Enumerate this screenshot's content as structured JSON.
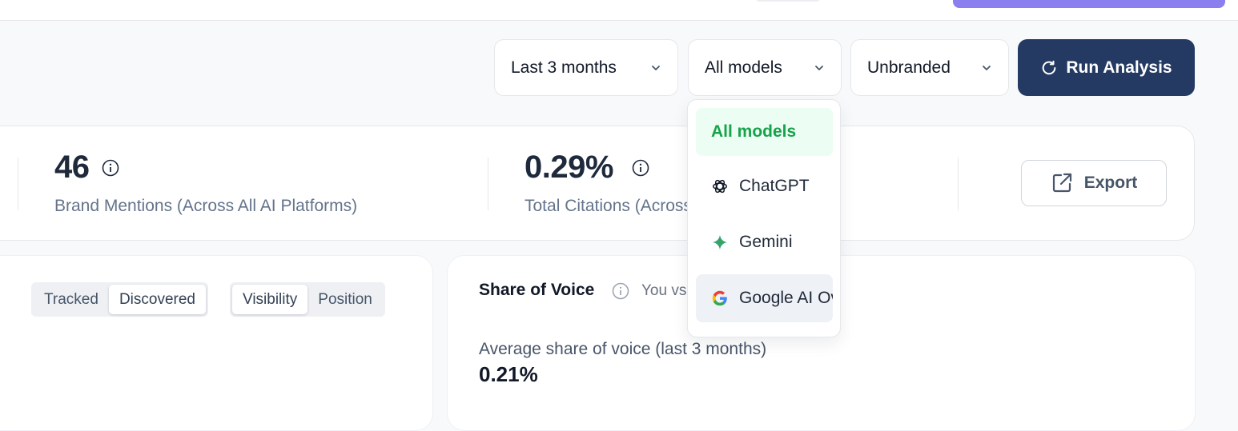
{
  "colors": {
    "primary": "#243a63",
    "accent": "#8b7ff0",
    "selected_text": "#16a34a",
    "selected_bg": "#ecfdf3"
  },
  "filters": {
    "period": "Last 3 months",
    "model": "All models",
    "branding": "Unbranded"
  },
  "actions": {
    "run_label": "Run Analysis",
    "export_label": "Export"
  },
  "stats": [
    {
      "value": "46",
      "label": "Brand Mentions (Across All AI Platforms)"
    },
    {
      "value": "0.29%",
      "label": "Total Citations (Across All AI Platforms)"
    }
  ],
  "toggles": {
    "source": [
      "Tracked",
      "Discovered"
    ],
    "source_active": "Discovered",
    "metric": [
      "Visibility",
      "Position"
    ],
    "metric_active": "Visibility"
  },
  "share_of_voice": {
    "title": "Share of Voice",
    "subtitle": "You vs competitors",
    "avg_label": "Average share of voice (last 3 months)",
    "avg_value": "0.21%"
  },
  "model_menu": {
    "items": [
      {
        "label": "All models",
        "icon": "none",
        "state": "selected"
      },
      {
        "label": "ChatGPT",
        "icon": "chatgpt-icon",
        "state": "default"
      },
      {
        "label": "Gemini",
        "icon": "gemini-icon",
        "state": "default"
      },
      {
        "label": "Google AI Overviews",
        "icon": "google-icon",
        "state": "hovered"
      }
    ]
  }
}
